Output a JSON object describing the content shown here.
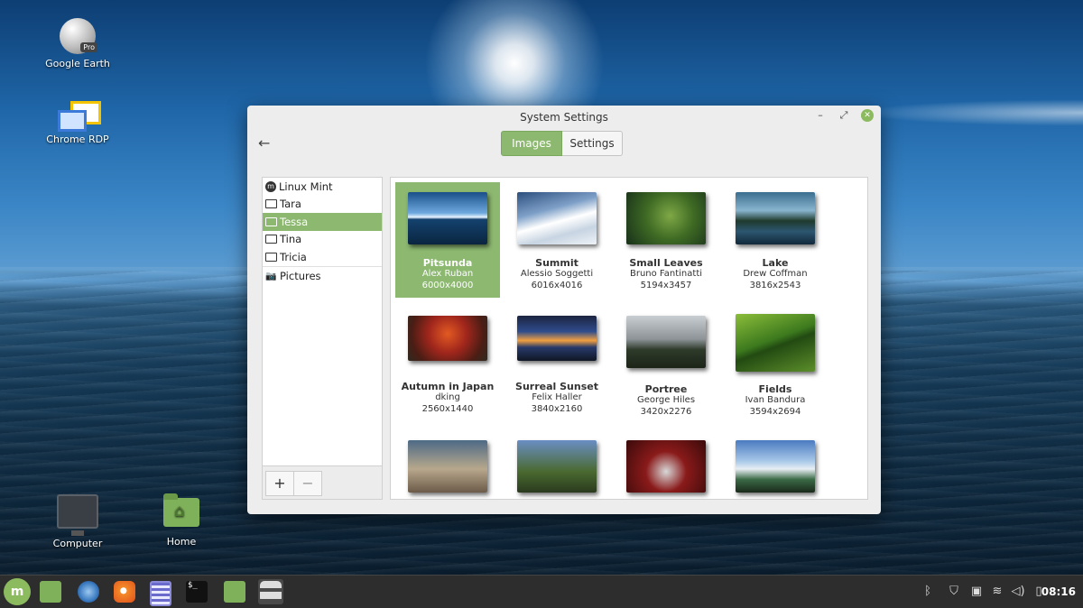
{
  "desktop": {
    "icons": [
      {
        "label": "Google Earth",
        "badge": "Pro"
      },
      {
        "label": "Chrome RDP"
      },
      {
        "label": "Computer"
      },
      {
        "label": "Home"
      }
    ]
  },
  "window": {
    "title": "System Settings",
    "tabs": [
      {
        "label": "Images",
        "active": true
      },
      {
        "label": "Settings",
        "active": false
      }
    ],
    "sidebar": {
      "items": [
        {
          "label": "Linux Mint",
          "icon": "linux-mint-icon"
        },
        {
          "label": "Tara",
          "icon": "monitor-icon"
        },
        {
          "label": "Tessa",
          "icon": "monitor-icon",
          "selected": true
        },
        {
          "label": "Tina",
          "icon": "monitor-icon"
        },
        {
          "label": "Tricia",
          "icon": "monitor-icon"
        },
        {
          "label": "Pictures",
          "icon": "camera-icon"
        }
      ],
      "add_label": "+",
      "remove_label": "−"
    },
    "wallpapers": [
      {
        "name": "Pitsunda",
        "author": "Alex Ruban",
        "size": "6000x4000",
        "selected": true
      },
      {
        "name": "Summit",
        "author": "Alessio Soggetti",
        "size": "6016x4016"
      },
      {
        "name": "Small Leaves",
        "author": "Bruno Fantinatti",
        "size": "5194x3457"
      },
      {
        "name": "Lake",
        "author": "Drew Coffman",
        "size": "3816x2543"
      },
      {
        "name": "Autumn in Japan",
        "author": "dking",
        "size": "2560x1440"
      },
      {
        "name": "Surreal Sunset",
        "author": "Felix Haller",
        "size": "3840x2160"
      },
      {
        "name": "Portree",
        "author": "George Hiles",
        "size": "3420x2276"
      },
      {
        "name": "Fields",
        "author": "Ivan Bandura",
        "size": "3594x2694"
      }
    ]
  },
  "taskbar": {
    "menu_icon": "linux-mint-menu-icon",
    "launchers": [
      "show-desktop-icon",
      "browser-icon",
      "firefox-icon",
      "text-editor-icon",
      "terminal-icon",
      "files-icon",
      "system-settings-icon"
    ],
    "terminal_glyph": "$_",
    "tray": [
      "bluetooth-icon",
      "shield-icon",
      "clipboard-icon",
      "wifi-icon",
      "volume-icon",
      "battery-icon"
    ],
    "clock": "08:16"
  },
  "colors": {
    "accent": "#8cb870",
    "taskbar": "#2d2d2d"
  }
}
